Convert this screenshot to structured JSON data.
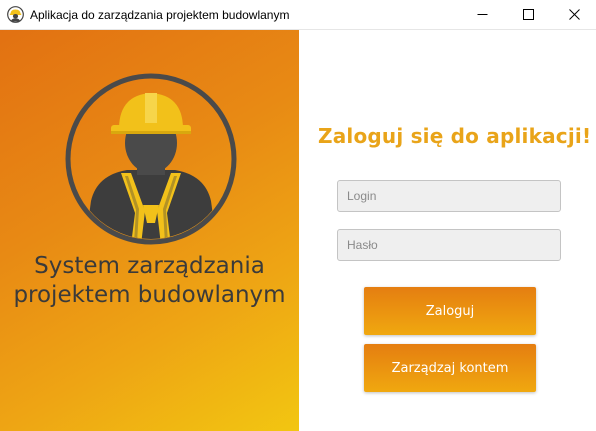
{
  "window": {
    "title": "Aplikacja do zarządzania projektem budowlanym",
    "icon": "construction-worker-icon"
  },
  "left_panel": {
    "title_line1": "System zarządzania",
    "title_line2": "projektem budowlanym",
    "illustration": "construction-worker-icon"
  },
  "login_form": {
    "heading": "Zaloguj się do aplikacji!",
    "login_placeholder": "Login",
    "password_placeholder": "Hasło",
    "login_value": "",
    "password_value": "",
    "login_button_label": "Zaloguj",
    "manage_account_button_label": "Zarządzaj kontem"
  },
  "colors": {
    "accent": "#e9a419",
    "gradient_start": "#e27112",
    "gradient_end": "#f2c611",
    "title_text": "#3a3a3a",
    "button_text": "#ffffff"
  }
}
